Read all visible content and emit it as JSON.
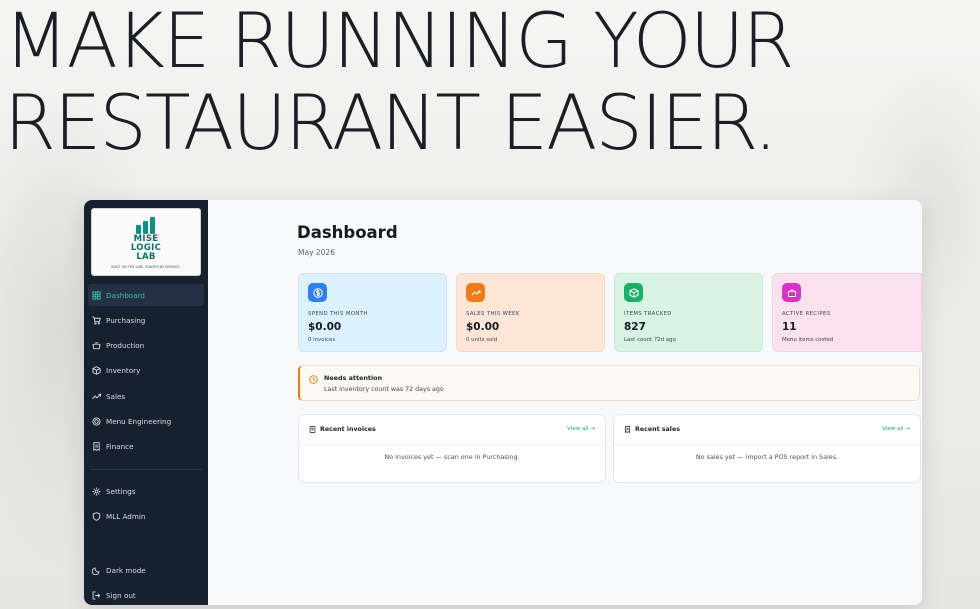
{
  "hero": {
    "line1": "MAKE RUNNING YOUR",
    "line2": "RESTAURANT EASIER."
  },
  "logo": {
    "line1": "MISE",
    "line2": "LOGIC",
    "line3": "LAB",
    "tagline": "BUILT ON THE LINE. SHAPED BY SERVICE."
  },
  "sidebar": {
    "items": [
      {
        "label": "Dashboard",
        "icon": "dashboard-grid-icon"
      },
      {
        "label": "Purchasing",
        "icon": "cart-icon"
      },
      {
        "label": "Production",
        "icon": "pot-icon"
      },
      {
        "label": "Inventory",
        "icon": "box-icon"
      },
      {
        "label": "Sales",
        "icon": "trend-up-icon"
      },
      {
        "label": "Menu Engineering",
        "icon": "target-icon"
      },
      {
        "label": "Finance",
        "icon": "receipt-icon"
      }
    ],
    "admin_items": [
      {
        "label": "Settings",
        "icon": "gear-icon"
      },
      {
        "label": "MLL Admin",
        "icon": "shield-icon"
      }
    ],
    "footer_items": [
      {
        "label": "Dark mode",
        "icon": "moon-icon"
      },
      {
        "label": "Sign out",
        "icon": "sign-out-icon"
      }
    ]
  },
  "main": {
    "title": "Dashboard",
    "subtitle": "May 2026"
  },
  "cards": [
    {
      "label": "SPEND THIS MONTH",
      "value": "$0.00",
      "note": "0 invoices",
      "icon": "dollar-icon",
      "bg": "#dbf1fd",
      "icon_bg": "#2f80ed"
    },
    {
      "label": "SALES THIS WEEK",
      "value": "$0.00",
      "note": "0 units sold",
      "icon": "trend-up-icon",
      "bg": "#fde6d6",
      "icon_bg": "#f07b1c"
    },
    {
      "label": "ITEMS TRACKED",
      "value": "827",
      "note": "Last count 72d ago",
      "icon": "box-icon",
      "bg": "#d8f3e4",
      "icon_bg": "#1fae6a"
    },
    {
      "label": "ACTIVE RECIPES",
      "value": "11",
      "note": "Menu items costed",
      "icon": "pot-icon",
      "bg": "#fbe0ef",
      "icon_bg": "#d635c4"
    }
  ],
  "alert": {
    "title": "Needs attention",
    "body": "Last inventory count was 72 days ago",
    "icon": "clock-icon",
    "accent": "#ea7b14"
  },
  "panels": [
    {
      "title": "Recent invoices",
      "link": "View all →",
      "empty": "No invoices yet — scan one in Purchasing.",
      "icon": "document-icon"
    },
    {
      "title": "Recent sales",
      "link": "View all →",
      "empty": "No sales yet — import a POS report in Sales.",
      "icon": "receipt-icon"
    }
  ],
  "colors": {
    "sidebar_bg": "#16202e",
    "active_accent": "#39c1a9",
    "link": "#1f9d8a"
  }
}
